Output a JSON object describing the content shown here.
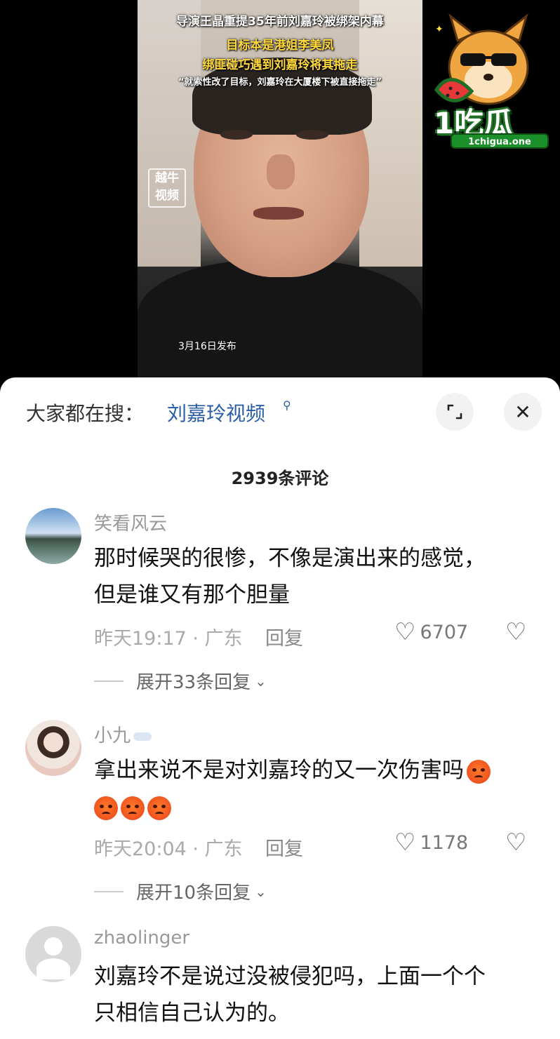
{
  "video": {
    "caption_line1": "导演王晶重提35年前刘嘉玲被绑架内幕",
    "caption_line2": "目标本是港姐李美凤",
    "caption_line3": "绑匪碰巧遇到刘嘉玲将其拖走",
    "caption_line4": "“就索性改了目标，刘嘉玲在大厦楼下被直接拖走”",
    "watermark": "越牛\n视频",
    "watermark_l1": "越牛",
    "watermark_l2": "视频",
    "publish_date": "3月16日发布"
  },
  "brand": {
    "name": "1吃瓜",
    "url": "1chigua.one"
  },
  "panel": {
    "search_prompt": "大家都在搜：",
    "search_term": "刘嘉玲视频",
    "comment_count": "2939条评论"
  },
  "comments": [
    {
      "username": "笑看风云",
      "text_l1": "那时候哭的很惨，不像是演出来的感觉，",
      "text_l2": "但是谁又有那个胆量",
      "time_location": "昨天19:17 · 广东",
      "reply_label": "回复",
      "likes": "6707",
      "expand_label": "展开33条回复"
    },
    {
      "username": "小九",
      "text_l1": "拿出来说不是对刘嘉玲的又一次伤害吗",
      "time_location": "昨天20:04 · 广东",
      "reply_label": "回复",
      "likes": "1178",
      "expand_label": "展开10条回复"
    },
    {
      "username": "zhaolinger",
      "text_l1": "刘嘉玲不是说过没被侵犯吗，上面一个个",
      "text_l2": "只相信自己认为的。"
    }
  ],
  "icons": {
    "search": "search-icon",
    "expand": "expand-icon",
    "close": "close-icon",
    "like": "heart-icon",
    "dislike": "broken-heart-icon",
    "chevron": "chevron-down-icon",
    "angry_emoji": "angry-face-icon"
  },
  "colors": {
    "link_blue": "#2a5ea8",
    "caption_yellow": "#ffd83d",
    "brand_green": "#1a8f2a"
  }
}
